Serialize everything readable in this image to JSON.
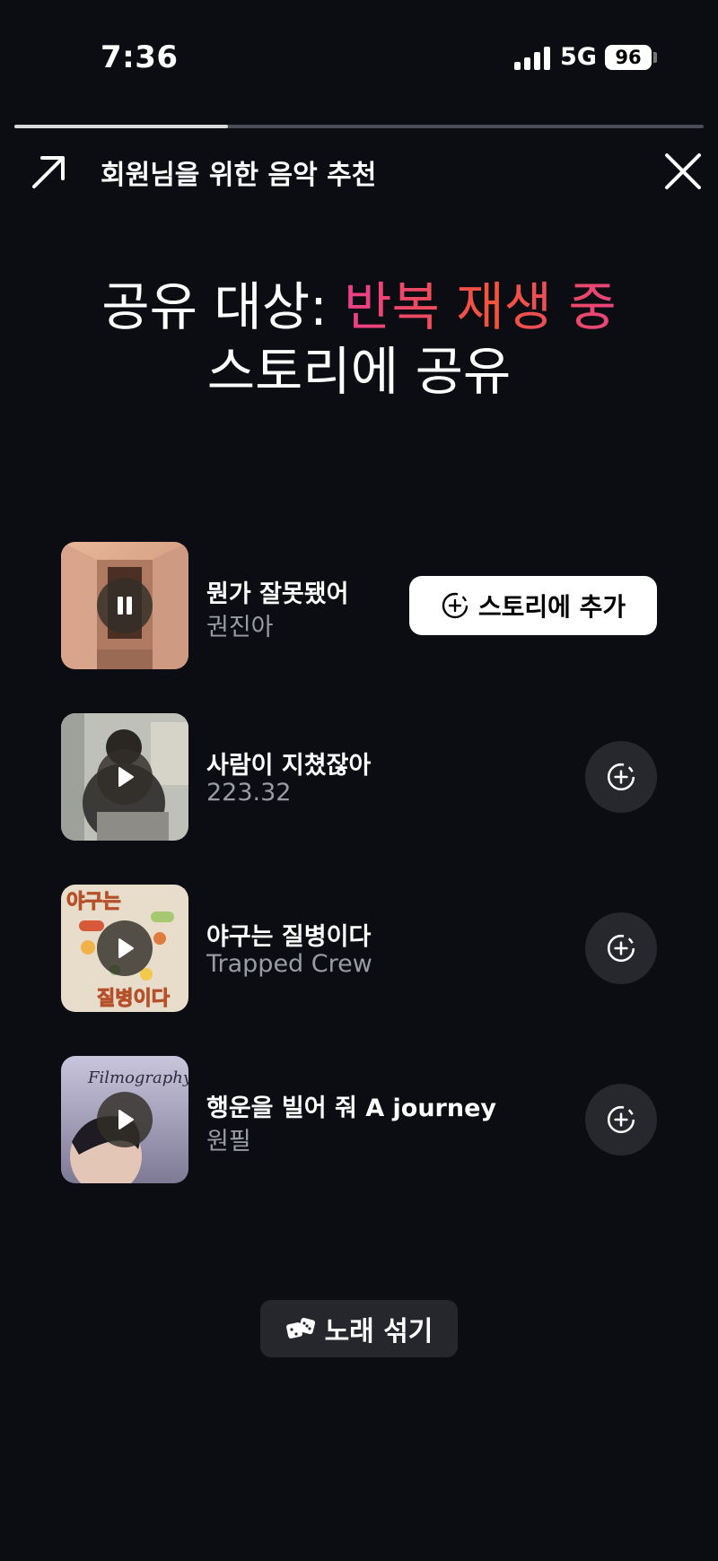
{
  "status_bar": {
    "time": "7:36",
    "network": "5G",
    "battery": "96"
  },
  "progress": {
    "fraction": 0.31
  },
  "header": {
    "title": "회원님을 위한 음악 추천"
  },
  "headline": {
    "prefix": "공유 대상: ",
    "highlight": "반복 재생 중",
    "line2": "스토리에 공유"
  },
  "tracks": [
    {
      "title": "뭔가 잘못됐어",
      "artist": "권진아",
      "state": "playing",
      "action_label": "스토리에 추가"
    },
    {
      "title": "사람이 지쳤잖아",
      "artist": "223.32",
      "state": "paused"
    },
    {
      "title": "야구는 질병이다",
      "artist": "Trapped Crew",
      "state": "paused",
      "art_text": "야구는 질병이다"
    },
    {
      "title": "행운을 빌어 줘 A journey",
      "artist": "원필",
      "state": "paused",
      "art_text": "Filmography"
    }
  ],
  "shuffle": {
    "label": "노래 섞기"
  },
  "colors": {
    "background": "#0b0d13",
    "accent_start": "#ec3f8a",
    "accent_end": "#f2553a"
  }
}
